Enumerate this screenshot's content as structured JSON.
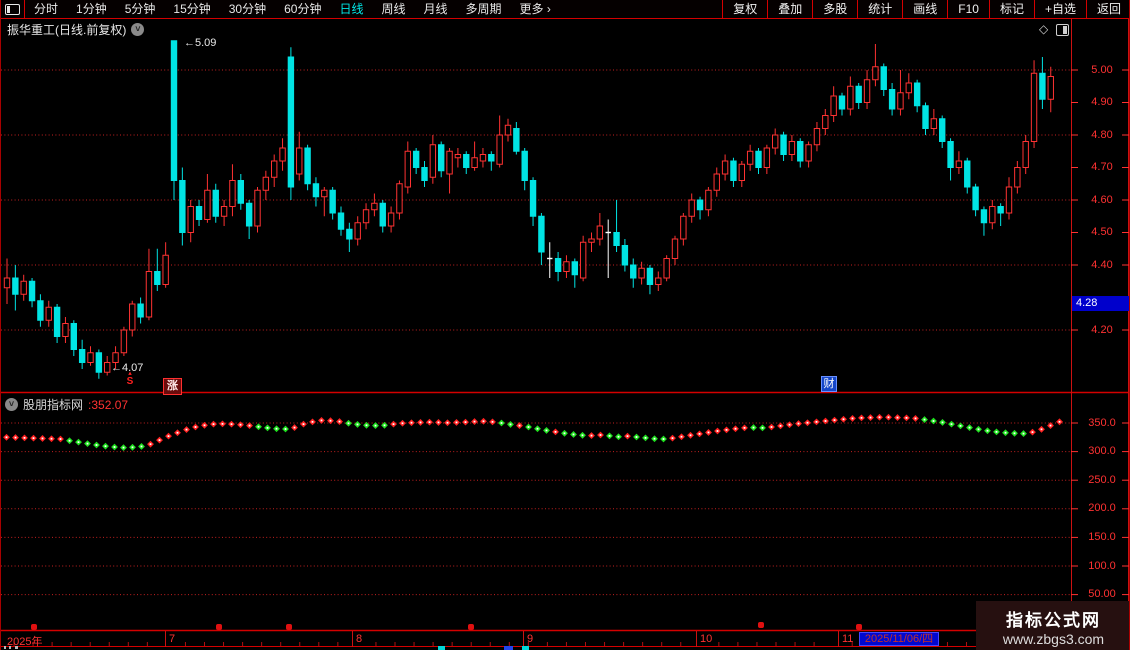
{
  "top_bar": {
    "left_items": [
      {
        "label": "分时",
        "active": false
      },
      {
        "label": "1分钟",
        "active": false
      },
      {
        "label": "5分钟",
        "active": false
      },
      {
        "label": "15分钟",
        "active": false
      },
      {
        "label": "30分钟",
        "active": false
      },
      {
        "label": "60分钟",
        "active": false
      },
      {
        "label": "日线",
        "active": true
      },
      {
        "label": "周线",
        "active": false
      },
      {
        "label": "月线",
        "active": false
      },
      {
        "label": "多周期",
        "active": false
      },
      {
        "label": "更多 ›",
        "active": false
      }
    ],
    "right_items": [
      "复权",
      "叠加",
      "多股",
      "统计",
      "画线",
      "F10",
      "标记",
      "+自选",
      "返回"
    ]
  },
  "title": {
    "text": "振华重工(日线.前复权)"
  },
  "main_chart": {
    "y_axis_labels": [
      "5.00",
      "4.90",
      "4.80",
      "4.70",
      "4.60",
      "4.50",
      "4.40",
      "4.20"
    ],
    "price_tag": "4.28",
    "high_annotation": "←5.09",
    "low_annotation": "←4.07",
    "buy_marker_arrow": "▴",
    "buy_marker": "S",
    "stamp_label": "涨",
    "badge_label": "财"
  },
  "indicator_panel": {
    "name": "股朋指标网",
    "value": ":352.07",
    "y_axis_labels": [
      "350.0",
      "300.0",
      "250.0",
      "200.0",
      "150.0",
      "100.0",
      "50.00"
    ]
  },
  "timeline": {
    "labels": [
      "2025年",
      "7",
      "8",
      "9",
      "10",
      "11"
    ],
    "date_box": "2025/11/06/四"
  },
  "watermark": {
    "line1": "指标公式网",
    "line2": "www.zbgs3.com"
  },
  "colors": {
    "up": "#ff3232",
    "down": "#00e4e4",
    "doji": "#ffffff",
    "grid": "#c42020",
    "dot_red": "#ff2020",
    "dot_green": "#1ee01e",
    "axis_text": "#ff3232",
    "blue_tag": "#0000cc"
  },
  "chart_data": [
    {
      "type": "candlestick",
      "title": "振华重工 日线 前复权",
      "ylabel": "price",
      "ylim": [
        4.02,
        5.12
      ],
      "x_months": [
        "2025-07",
        "2025-08",
        "2025-09",
        "2025-10",
        "2025-11"
      ],
      "grid_prices": [
        5.0,
        4.8,
        4.6,
        4.4,
        4.2
      ],
      "ohlc": [
        [
          4.33,
          4.42,
          4.28,
          4.36
        ],
        [
          4.36,
          4.4,
          4.26,
          4.31
        ],
        [
          4.31,
          4.37,
          4.29,
          4.35
        ],
        [
          4.35,
          4.36,
          4.27,
          4.29
        ],
        [
          4.29,
          4.31,
          4.21,
          4.23
        ],
        [
          4.23,
          4.29,
          4.21,
          4.27
        ],
        [
          4.27,
          4.28,
          4.16,
          4.18
        ],
        [
          4.18,
          4.24,
          4.16,
          4.22
        ],
        [
          4.22,
          4.23,
          4.12,
          4.14
        ],
        [
          4.14,
          4.17,
          4.08,
          4.1
        ],
        [
          4.1,
          4.15,
          4.09,
          4.13
        ],
        [
          4.13,
          4.14,
          4.05,
          4.07
        ],
        [
          4.07,
          4.12,
          4.06,
          4.1
        ],
        [
          4.1,
          4.15,
          4.08,
          4.13
        ],
        [
          4.13,
          4.21,
          4.12,
          4.2
        ],
        [
          4.2,
          4.29,
          4.18,
          4.28
        ],
        [
          4.28,
          4.3,
          4.22,
          4.24
        ],
        [
          4.24,
          4.45,
          4.23,
          4.38
        ],
        [
          4.38,
          4.45,
          4.32,
          4.34
        ],
        [
          4.34,
          4.47,
          4.33,
          4.43
        ],
        [
          5.09,
          5.09,
          4.6,
          4.66
        ],
        [
          4.66,
          4.7,
          4.46,
          4.5
        ],
        [
          4.5,
          4.6,
          4.47,
          4.58
        ],
        [
          4.58,
          4.6,
          4.52,
          4.54
        ],
        [
          4.54,
          4.68,
          4.53,
          4.63
        ],
        [
          4.63,
          4.65,
          4.53,
          4.55
        ],
        [
          4.55,
          4.6,
          4.52,
          4.58
        ],
        [
          4.58,
          4.71,
          4.55,
          4.66
        ],
        [
          4.66,
          4.68,
          4.57,
          4.59
        ],
        [
          4.59,
          4.6,
          4.48,
          4.52
        ],
        [
          4.52,
          4.64,
          4.5,
          4.63
        ],
        [
          4.63,
          4.69,
          4.6,
          4.67
        ],
        [
          4.67,
          4.74,
          4.64,
          4.72
        ],
        [
          4.72,
          4.79,
          4.69,
          4.76
        ],
        [
          5.04,
          5.07,
          4.6,
          4.64
        ],
        [
          4.68,
          4.81,
          4.66,
          4.76
        ],
        [
          4.76,
          4.77,
          4.63,
          4.65
        ],
        [
          4.65,
          4.67,
          4.58,
          4.61
        ],
        [
          4.61,
          4.64,
          4.55,
          4.63
        ],
        [
          4.63,
          4.64,
          4.54,
          4.56
        ],
        [
          4.56,
          4.58,
          4.49,
          4.51
        ],
        [
          4.51,
          4.53,
          4.44,
          4.48
        ],
        [
          4.48,
          4.55,
          4.46,
          4.53
        ],
        [
          4.53,
          4.59,
          4.51,
          4.57
        ],
        [
          4.57,
          4.62,
          4.55,
          4.59
        ],
        [
          4.59,
          4.6,
          4.5,
          4.52
        ],
        [
          4.52,
          4.58,
          4.5,
          4.56
        ],
        [
          4.56,
          4.66,
          4.54,
          4.65
        ],
        [
          4.64,
          4.78,
          4.62,
          4.75
        ],
        [
          4.75,
          4.76,
          4.68,
          4.7
        ],
        [
          4.7,
          4.72,
          4.64,
          4.66
        ],
        [
          4.67,
          4.8,
          4.65,
          4.77
        ],
        [
          4.77,
          4.78,
          4.67,
          4.69
        ],
        [
          4.68,
          4.76,
          4.62,
          4.75
        ],
        [
          4.73,
          4.76,
          4.7,
          4.74
        ],
        [
          4.74,
          4.75,
          4.68,
          4.7
        ],
        [
          4.7,
          4.78,
          4.69,
          4.73
        ],
        [
          4.72,
          4.76,
          4.7,
          4.74
        ],
        [
          4.74,
          4.75,
          4.69,
          4.72
        ],
        [
          4.71,
          4.86,
          4.7,
          4.8
        ],
        [
          4.8,
          4.85,
          4.78,
          4.83
        ],
        [
          4.82,
          4.84,
          4.74,
          4.75
        ],
        [
          4.75,
          4.76,
          4.63,
          4.66
        ],
        [
          4.66,
          4.67,
          4.52,
          4.55
        ],
        [
          4.55,
          4.56,
          4.4,
          4.44
        ],
        [
          4.42,
          4.47,
          4.36,
          4.42
        ],
        [
          4.42,
          4.44,
          4.35,
          4.38
        ],
        [
          4.38,
          4.43,
          4.36,
          4.41
        ],
        [
          4.41,
          4.42,
          4.33,
          4.37
        ],
        [
          4.36,
          4.49,
          4.35,
          4.47
        ],
        [
          4.47,
          4.5,
          4.44,
          4.48
        ],
        [
          4.48,
          4.56,
          4.46,
          4.52
        ],
        [
          4.5,
          4.54,
          4.36,
          4.5
        ],
        [
          4.5,
          4.6,
          4.44,
          4.46
        ],
        [
          4.46,
          4.48,
          4.38,
          4.4
        ],
        [
          4.4,
          4.42,
          4.33,
          4.36
        ],
        [
          4.36,
          4.41,
          4.34,
          4.39
        ],
        [
          4.39,
          4.4,
          4.31,
          4.34
        ],
        [
          4.34,
          4.38,
          4.32,
          4.36
        ],
        [
          4.36,
          4.43,
          4.35,
          4.42
        ],
        [
          4.42,
          4.49,
          4.4,
          4.48
        ],
        [
          4.48,
          4.56,
          4.46,
          4.55
        ],
        [
          4.55,
          4.62,
          4.53,
          4.6
        ],
        [
          4.6,
          4.61,
          4.54,
          4.57
        ],
        [
          4.57,
          4.64,
          4.55,
          4.63
        ],
        [
          4.63,
          4.7,
          4.61,
          4.68
        ],
        [
          4.68,
          4.74,
          4.66,
          4.72
        ],
        [
          4.72,
          4.73,
          4.64,
          4.66
        ],
        [
          4.66,
          4.72,
          4.64,
          4.71
        ],
        [
          4.71,
          4.77,
          4.69,
          4.75
        ],
        [
          4.75,
          4.76,
          4.68,
          4.7
        ],
        [
          4.7,
          4.77,
          4.68,
          4.76
        ],
        [
          4.76,
          4.82,
          4.74,
          4.8
        ],
        [
          4.8,
          4.81,
          4.72,
          4.74
        ],
        [
          4.74,
          4.8,
          4.72,
          4.78
        ],
        [
          4.78,
          4.79,
          4.7,
          4.72
        ],
        [
          4.72,
          4.78,
          4.7,
          4.77
        ],
        [
          4.77,
          4.84,
          4.75,
          4.82
        ],
        [
          4.82,
          4.88,
          4.8,
          4.86
        ],
        [
          4.86,
          4.95,
          4.84,
          4.92
        ],
        [
          4.92,
          4.93,
          4.86,
          4.88
        ],
        [
          4.88,
          4.98,
          4.86,
          4.95
        ],
        [
          4.95,
          4.96,
          4.88,
          4.9
        ],
        [
          4.9,
          5.0,
          4.88,
          4.97
        ],
        [
          4.97,
          5.08,
          4.95,
          5.01
        ],
        [
          5.01,
          5.02,
          4.92,
          4.94
        ],
        [
          4.94,
          4.96,
          4.86,
          4.88
        ],
        [
          4.88,
          5.0,
          4.86,
          4.93
        ],
        [
          4.93,
          4.99,
          4.91,
          4.96
        ],
        [
          4.96,
          4.97,
          4.87,
          4.89
        ],
        [
          4.89,
          4.9,
          4.8,
          4.82
        ],
        [
          4.82,
          4.88,
          4.8,
          4.85
        ],
        [
          4.85,
          4.86,
          4.76,
          4.78
        ],
        [
          4.78,
          4.79,
          4.66,
          4.7
        ],
        [
          4.7,
          4.75,
          4.68,
          4.72
        ],
        [
          4.72,
          4.73,
          4.62,
          4.64
        ],
        [
          4.64,
          4.65,
          4.55,
          4.57
        ],
        [
          4.57,
          4.58,
          4.49,
          4.53
        ],
        [
          4.53,
          4.6,
          4.51,
          4.58
        ],
        [
          4.58,
          4.59,
          4.52,
          4.56
        ],
        [
          4.56,
          4.67,
          4.54,
          4.64
        ],
        [
          4.64,
          4.72,
          4.62,
          4.7
        ],
        [
          4.7,
          4.8,
          4.68,
          4.78
        ],
        [
          4.78,
          5.03,
          4.76,
          4.99
        ],
        [
          4.99,
          5.04,
          4.88,
          4.91
        ],
        [
          4.91,
          5.01,
          4.87,
          4.98
        ]
      ]
    },
    {
      "type": "scatter",
      "name": "股朋指标网",
      "last_value": 352.07,
      "ylim": [
        40,
        364
      ],
      "grid_values": [
        350,
        300,
        250,
        200,
        150,
        100,
        50
      ],
      "points": [
        [
          325,
          "r"
        ],
        [
          324.5,
          "r"
        ],
        [
          324,
          "r"
        ],
        [
          323.5,
          "r"
        ],
        [
          323,
          "r"
        ],
        [
          322.5,
          "r"
        ],
        [
          322,
          "r"
        ],
        [
          319,
          "g"
        ],
        [
          316.5,
          "g"
        ],
        [
          314,
          "g"
        ],
        [
          311.5,
          "g"
        ],
        [
          309.5,
          "g"
        ],
        [
          308,
          "g"
        ],
        [
          307,
          "g"
        ],
        [
          307.5,
          "g"
        ],
        [
          309,
          "g"
        ],
        [
          313,
          "r"
        ],
        [
          320,
          "r"
        ],
        [
          327,
          "r"
        ],
        [
          333,
          "r"
        ],
        [
          338.5,
          "r"
        ],
        [
          343,
          "r"
        ],
        [
          346,
          "r"
        ],
        [
          348,
          "r"
        ],
        [
          348.5,
          "r"
        ],
        [
          348,
          "r"
        ],
        [
          347,
          "r"
        ],
        [
          345.5,
          "r"
        ],
        [
          343.5,
          "g"
        ],
        [
          341.5,
          "g"
        ],
        [
          340,
          "g"
        ],
        [
          339.5,
          "g"
        ],
        [
          342,
          "r"
        ],
        [
          348,
          "r"
        ],
        [
          352,
          "r"
        ],
        [
          354.5,
          "r"
        ],
        [
          354,
          "r"
        ],
        [
          352.5,
          "r"
        ],
        [
          349.5,
          "g"
        ],
        [
          347.5,
          "g"
        ],
        [
          346,
          "g"
        ],
        [
          345.5,
          "g"
        ],
        [
          346,
          "g"
        ],
        [
          348,
          "r"
        ],
        [
          349.5,
          "r"
        ],
        [
          350.5,
          "r"
        ],
        [
          351,
          "r"
        ],
        [
          351.5,
          "r"
        ],
        [
          351,
          "r"
        ],
        [
          350.5,
          "r"
        ],
        [
          351,
          "r"
        ],
        [
          351.5,
          "r"
        ],
        [
          352.5,
          "r"
        ],
        [
          353,
          "r"
        ],
        [
          352,
          "r"
        ],
        [
          350,
          "g"
        ],
        [
          347.5,
          "g"
        ],
        [
          345.5,
          "r"
        ],
        [
          343,
          "g"
        ],
        [
          340,
          "g"
        ],
        [
          337,
          "g"
        ],
        [
          334.5,
          "r"
        ],
        [
          332,
          "g"
        ],
        [
          330,
          "g"
        ],
        [
          328.5,
          "g"
        ],
        [
          328,
          "r"
        ],
        [
          329,
          "r"
        ],
        [
          327.5,
          "g"
        ],
        [
          326,
          "g"
        ],
        [
          327,
          "r"
        ],
        [
          325.5,
          "g"
        ],
        [
          324,
          "g"
        ],
        [
          322.5,
          "g"
        ],
        [
          322,
          "g"
        ],
        [
          323.5,
          "r"
        ],
        [
          326,
          "r"
        ],
        [
          328.5,
          "r"
        ],
        [
          331,
          "r"
        ],
        [
          333.5,
          "r"
        ],
        [
          336,
          "r"
        ],
        [
          338,
          "r"
        ],
        [
          340,
          "r"
        ],
        [
          341.5,
          "r"
        ],
        [
          342,
          "g"
        ],
        [
          341.5,
          "g"
        ],
        [
          343,
          "r"
        ],
        [
          345,
          "r"
        ],
        [
          347,
          "r"
        ],
        [
          349,
          "r"
        ],
        [
          350.5,
          "r"
        ],
        [
          352,
          "r"
        ],
        [
          353.5,
          "r"
        ],
        [
          355,
          "r"
        ],
        [
          356.5,
          "r"
        ],
        [
          358,
          "r"
        ],
        [
          359,
          "r"
        ],
        [
          359.5,
          "r"
        ],
        [
          360,
          "r"
        ],
        [
          360,
          "r"
        ],
        [
          359.5,
          "r"
        ],
        [
          359,
          "r"
        ],
        [
          358,
          "r"
        ],
        [
          356,
          "g"
        ],
        [
          353.5,
          "g"
        ],
        [
          351,
          "g"
        ],
        [
          348,
          "g"
        ],
        [
          345,
          "g"
        ],
        [
          342,
          "g"
        ],
        [
          339,
          "g"
        ],
        [
          336.5,
          "g"
        ],
        [
          334.5,
          "g"
        ],
        [
          333,
          "g"
        ],
        [
          332,
          "g"
        ],
        [
          331.5,
          "g"
        ],
        [
          334,
          "r"
        ],
        [
          339,
          "r"
        ],
        [
          345.5,
          "r"
        ],
        [
          352.1,
          "r"
        ]
      ]
    }
  ]
}
